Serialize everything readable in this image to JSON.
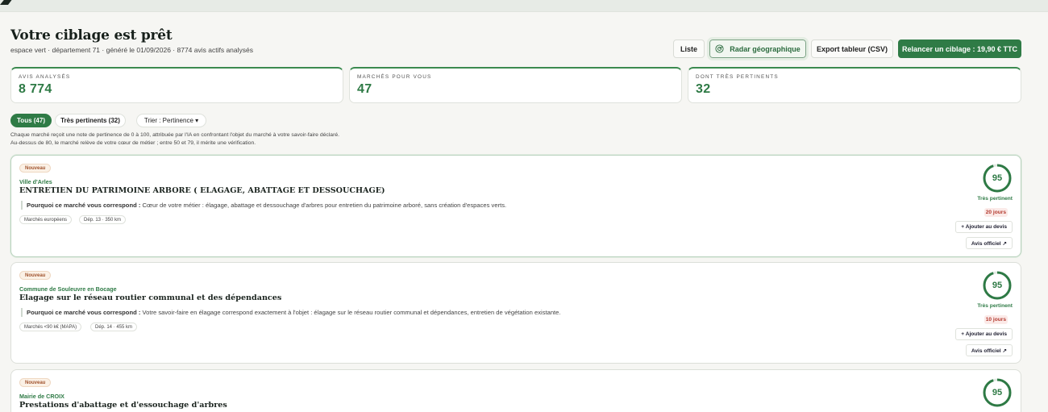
{
  "header": {
    "title": "Votre ciblage est prêt",
    "subtitle": "espace vert · département 71 · généré le 01/09/2026 · 8774 avis actifs analysés"
  },
  "actions": {
    "liste": "Liste",
    "radar": "Radar géographique",
    "csv": "Export tableur (CSV)",
    "relaunch": "Relancer un ciblage : 19,90 € TTC"
  },
  "stats": [
    {
      "label": "Avis analysés",
      "value": "8 774"
    },
    {
      "label": "Marchés pour vous",
      "value": "47"
    },
    {
      "label": "Dont très pertinents",
      "value": "32"
    }
  ],
  "filters": {
    "all": "Tous (47)",
    "pertinent": "Très pertinents (32)",
    "sort": "Trier : Pertinence ▾"
  },
  "note": {
    "line1": "Chaque marché reçoit une note de pertinence de 0 à 100, attribuée par l'IA en confrontant l'objet du marché à votre savoir-faire déclaré.",
    "line2": "Au-dessus de 80, le marché relève de votre cœur de métier ; entre 50 et 79, il mérite une vérification."
  },
  "colors": {
    "accent": "#2f7b46",
    "deadline": "#b33a2f",
    "new_badge": "#a0522d"
  },
  "cards": [
    {
      "badge": "Nouveau",
      "buyer": "Ville d'Arles",
      "title": "ENTRETIEN DU PATRIMOINE ARBORE ( ELAGAGE, ABATTAGE ET DESSOUCHAGE)",
      "reason_label": "Pourquoi ce marché vous correspond :",
      "reason_text": "Cœur de votre métier : élagage, abattage et dessouchage d'arbres pour entretien du patrimoine arboré, sans création d'espaces verts.",
      "tags": [
        "Marchés européens",
        "Dép. 13 · 350 km"
      ],
      "score": "95",
      "score_fraction": 0.95,
      "relevance": "Très pertinent",
      "deadline": "20 jours",
      "add_label": "+ Ajouter au devis",
      "official_label": "Avis officiel ↗"
    },
    {
      "badge": "Nouveau",
      "buyer": "Commune de Souleuvre en Bocage",
      "title": "Elagage sur le réseau routier communal et des dépendances",
      "reason_label": "Pourquoi ce marché vous correspond :",
      "reason_text": "Votre savoir-faire en élagage correspond exactement à l'objet : élagage sur le réseau routier communal et dépendances, entretien de végétation existante.",
      "tags": [
        "Marchés <90 k€ (MAPA)",
        "Dép. 14 · 455 km"
      ],
      "score": "95",
      "score_fraction": 0.95,
      "relevance": "Très pertinent",
      "deadline": "10 jours",
      "add_label": "+ Ajouter au devis",
      "official_label": "Avis officiel ↗"
    },
    {
      "badge": "Nouveau",
      "buyer": "Mairie de CROIX",
      "title": "Prestations d'abattage et d'essouchage d'arbres",
      "score": "95",
      "score_fraction": 0.95
    }
  ]
}
